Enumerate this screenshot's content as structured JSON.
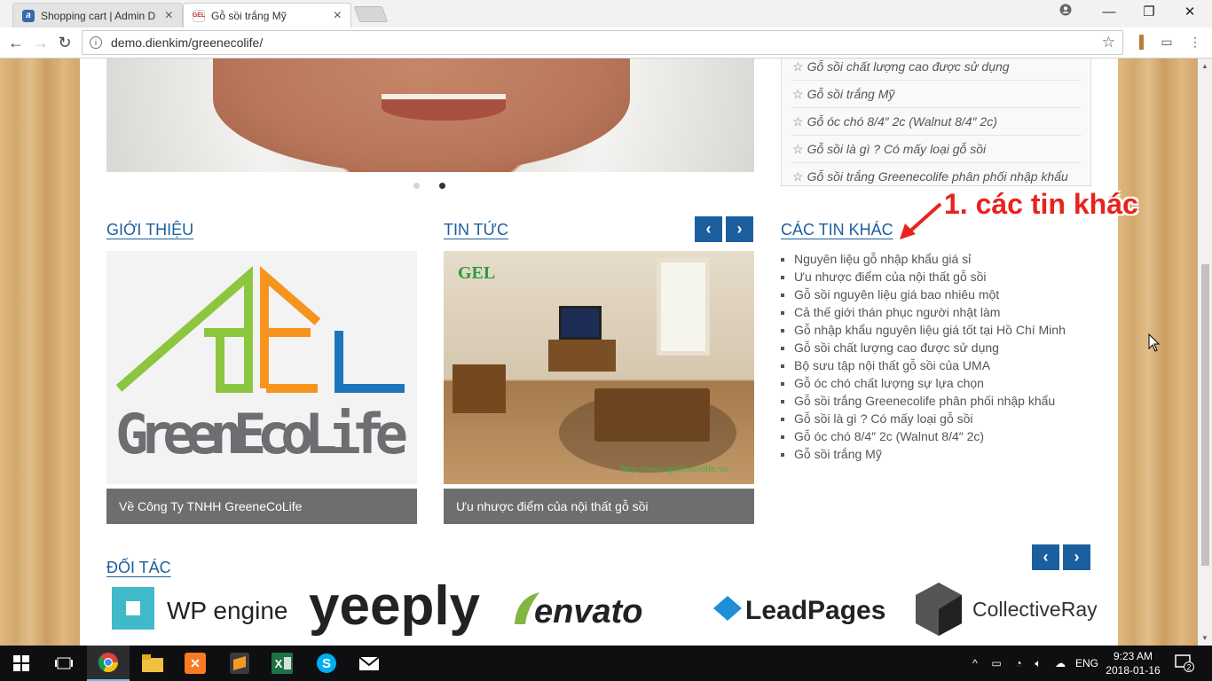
{
  "browser": {
    "tabs": [
      {
        "title": "Shopping cart | Admin D",
        "favicon": "a"
      },
      {
        "title": "Gỗ sồi trắng Mỹ",
        "favicon": "site-logo"
      }
    ],
    "url": "demo.dienkim/greenecolife/"
  },
  "recent_posts": {
    "items": [
      "Gỗ sồi chất lượng cao được sử dụng",
      "Gỗ sồi trắng Mỹ",
      "Gỗ óc chó 8/4″ 2c (Walnut 8/4″ 2c)",
      "Gỗ sồi là gì ? Có mấy loại gỗ sồi",
      "Gỗ sồi trắng Greenecolife phân phối nhập khẩu"
    ]
  },
  "sections": {
    "about": {
      "title": "GIỚI THIỆU",
      "caption": "Về Công Ty TNHH GreeneCoLife",
      "logo_text": "GreenEcoLife"
    },
    "news": {
      "title": "TIN TỨC",
      "caption": "Ưu nhược điểm của nội thất gỗ sồi",
      "watermark": "GEL",
      "image_url_text": "http://www.greenecolife.vn"
    },
    "other_news": {
      "title": "CÁC TIN KHÁC",
      "items": [
        "Nguyên liệu gỗ nhập khẩu giá sỉ",
        "Ưu nhược điểm của nội thất gỗ sồi",
        "Gỗ sồi nguyên liệu giá bao nhiêu một",
        "Cả thế giới thán phục người nhật làm",
        "Gỗ nhập khẩu nguyên liệu giá tốt tại Hồ Chí Minh",
        "Gỗ sồi chất lượng cao được sử dụng",
        "Bộ sưu tập nội thất gỗ sồi của UMA",
        "Gỗ óc chó chất lượng sự lựa chọn",
        "Gỗ sồi trắng Greenecolife phân phối nhập khẩu",
        "Gỗ sồi là gì ? Có mấy loại gỗ sồi",
        "Gỗ óc chó 8/4″ 2c (Walnut 8/4″ 2c)",
        "Gỗ sồi trắng Mỹ"
      ]
    },
    "partners": {
      "title": "ĐỐI TÁC",
      "logos": [
        "WP engine",
        "yeeply",
        "envato",
        "LeadPages",
        "CollectiveRay"
      ]
    }
  },
  "annotation": "1. các tin khác",
  "slider": {
    "active_dot": 2,
    "dot_count": 2
  },
  "taskbar": {
    "language": "ENG",
    "time": "9:23 AM",
    "date": "2018-01-16",
    "notifications": "2"
  },
  "colors": {
    "accent": "#1b5f9e",
    "caption_bg": "#6e6e6e",
    "annotation": "#e8231d"
  }
}
